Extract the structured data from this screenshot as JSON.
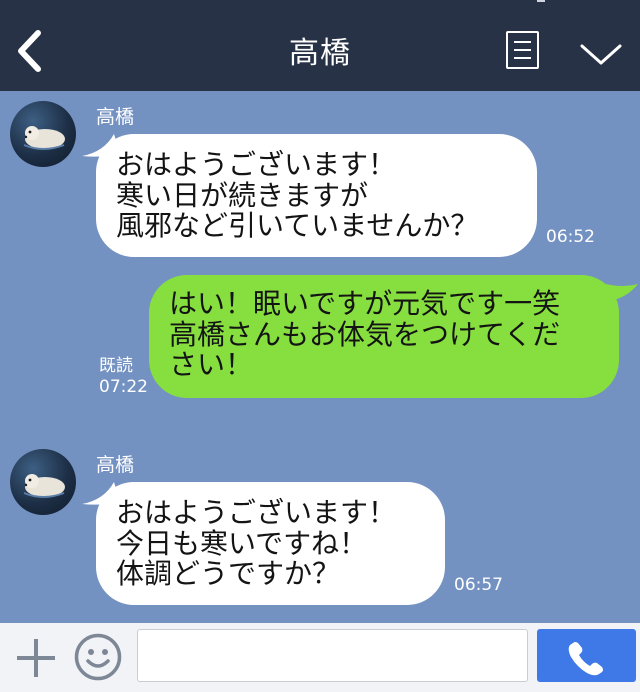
{
  "header": {
    "title": "高橋",
    "back_icon": "chevron-left-icon",
    "menu_icon": "menu-list-icon",
    "expand_icon": "chevron-down-icon"
  },
  "messages": [
    {
      "sender": "高橋",
      "direction": "incoming",
      "text": "おはようございます！\n寒い日が続きますが\n風邪など引いていませんか？",
      "time": "06:52"
    },
    {
      "direction": "outgoing",
      "text": "はい！眠いですが元気です一笑\n高橋さんもお体気をつけてくだ\nさい！",
      "read_label": "既読",
      "time": "07:22"
    },
    {
      "sender": "高橋",
      "direction": "incoming",
      "text": "おはようございます！\n今日も寒いですね！\n体調どうですか？",
      "time": "06:57"
    }
  ],
  "input_bar": {
    "plus_icon": "plus-icon",
    "emoji_icon": "smiley-icon",
    "message_value": "",
    "call_icon": "phone-icon"
  },
  "colors": {
    "header_bg": "#273246",
    "chat_bg": "#7391c1",
    "incoming_bubble": "#ffffff",
    "outgoing_bubble": "#86df3e",
    "call_button": "#3f79e7"
  }
}
